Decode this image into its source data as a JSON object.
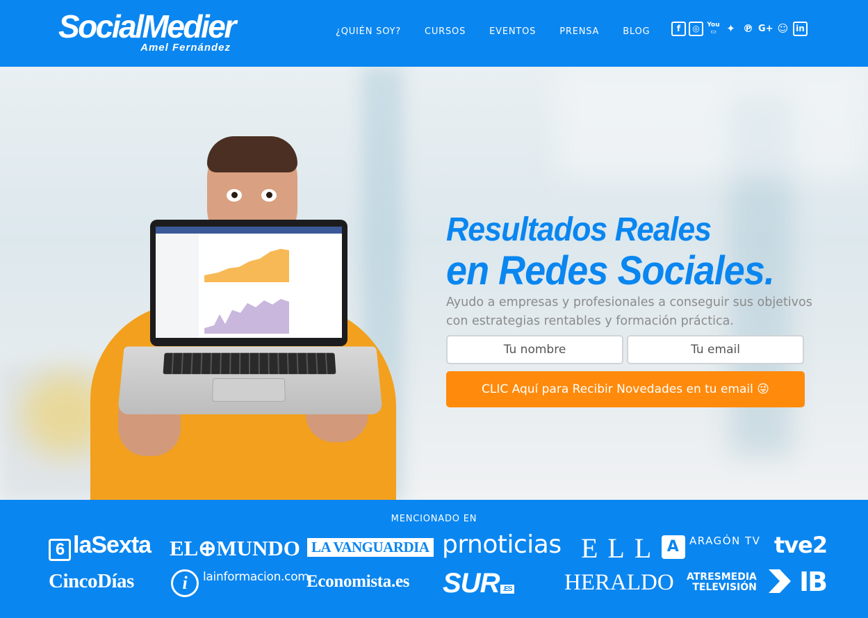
{
  "header": {
    "logo": {
      "title": "SocialMedier",
      "subtitle": "Amel Fernández"
    },
    "nav": [
      "¿QUIÉN SOY?",
      "CURSOS",
      "EVENTOS",
      "PRENSA",
      "BLOG"
    ],
    "social_icons": [
      "facebook-icon",
      "instagram-icon",
      "youtube-icon",
      "twitter-icon",
      "pinterest-icon",
      "google-plus-icon",
      "ivoox-icon",
      "linkedin-icon"
    ]
  },
  "hero": {
    "headline_line1": "Resultados Reales",
    "headline_line2": "en Redes Sociales.",
    "subtitle": "Ayudo a empresas y profesionales a conseguir sus objetivos con estrategias rentables y formación práctica.",
    "name_placeholder": "Tu nombre",
    "email_placeholder": "Tu email",
    "cta_label": "CLIC Aquí para Recibir Novedades en tu email 😜"
  },
  "mentions": {
    "title": "MENCIONADO EN",
    "outlets": {
      "lasexta": {
        "mark": "6",
        "name": "laSexta"
      },
      "elmundo": "EL⊕MUNDO",
      "lavanguardia": "LA VANGUARDIA",
      "prnoticias": "prnoticias",
      "elle": "ELLE",
      "aragontv": {
        "mark": "A",
        "name": "ARAGÓN TV"
      },
      "tve2": "tve2",
      "cincodias": "CincoDías",
      "lainformacion": {
        "mark": "i",
        "name": "lainformacion.com"
      },
      "economista": "Economista.es",
      "sur": {
        "name": "SUR",
        "suffix": ".ES"
      },
      "heraldo": "HERALDO",
      "atresmedia": {
        "line1": "ATRESMEDIA",
        "line2": "TELEVISIÓN"
      },
      "ib3": "IB"
    }
  },
  "colors": {
    "brand_blue": "#0a86f0",
    "cta_orange": "#ff8a0c",
    "text_gray": "#8b8b8b"
  }
}
